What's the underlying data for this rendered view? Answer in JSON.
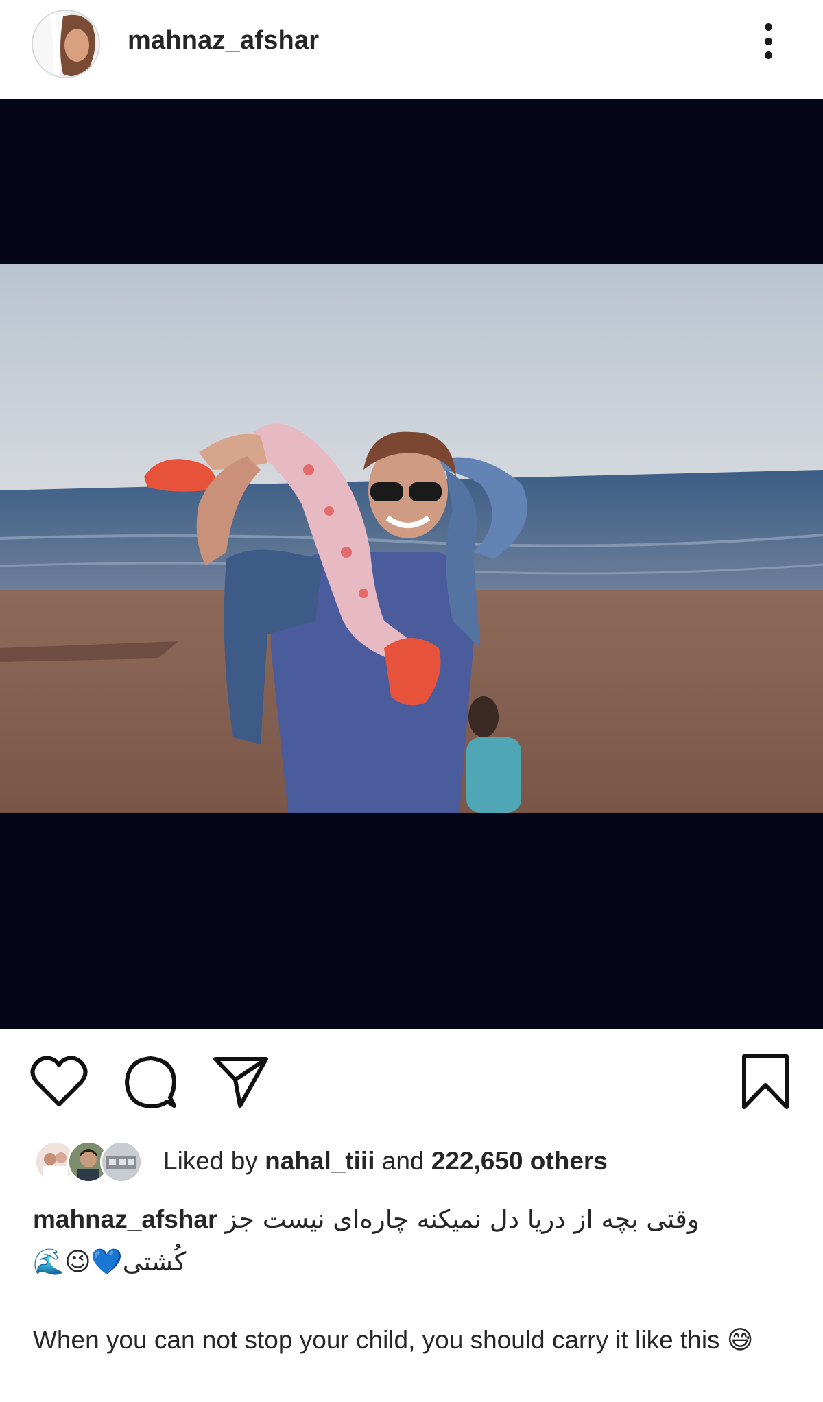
{
  "post": {
    "username": "mahnaz_afshar"
  },
  "icons": {
    "more": "more-vertical-icon",
    "like": "heart-icon",
    "comment": "comment-icon",
    "share": "send-icon",
    "save": "bookmark-icon"
  },
  "likes": {
    "prefix": "Liked by",
    "user": "nahal_tiii",
    "and": "and",
    "count": "222,650 others"
  },
  "caption": {
    "username": "mahnaz_afshar",
    "text_fa_line1": "وقتی بچه از دریا دل نمیکنه چاره‌ای نیست جز",
    "text_fa_line2": "کُشتی💙😉🌊",
    "text_en": "When you can not stop your child, you should carry it like this",
    "text_en_emoji": "😅"
  },
  "colors": {
    "media_bg": "#06061a",
    "text": "#262626"
  }
}
